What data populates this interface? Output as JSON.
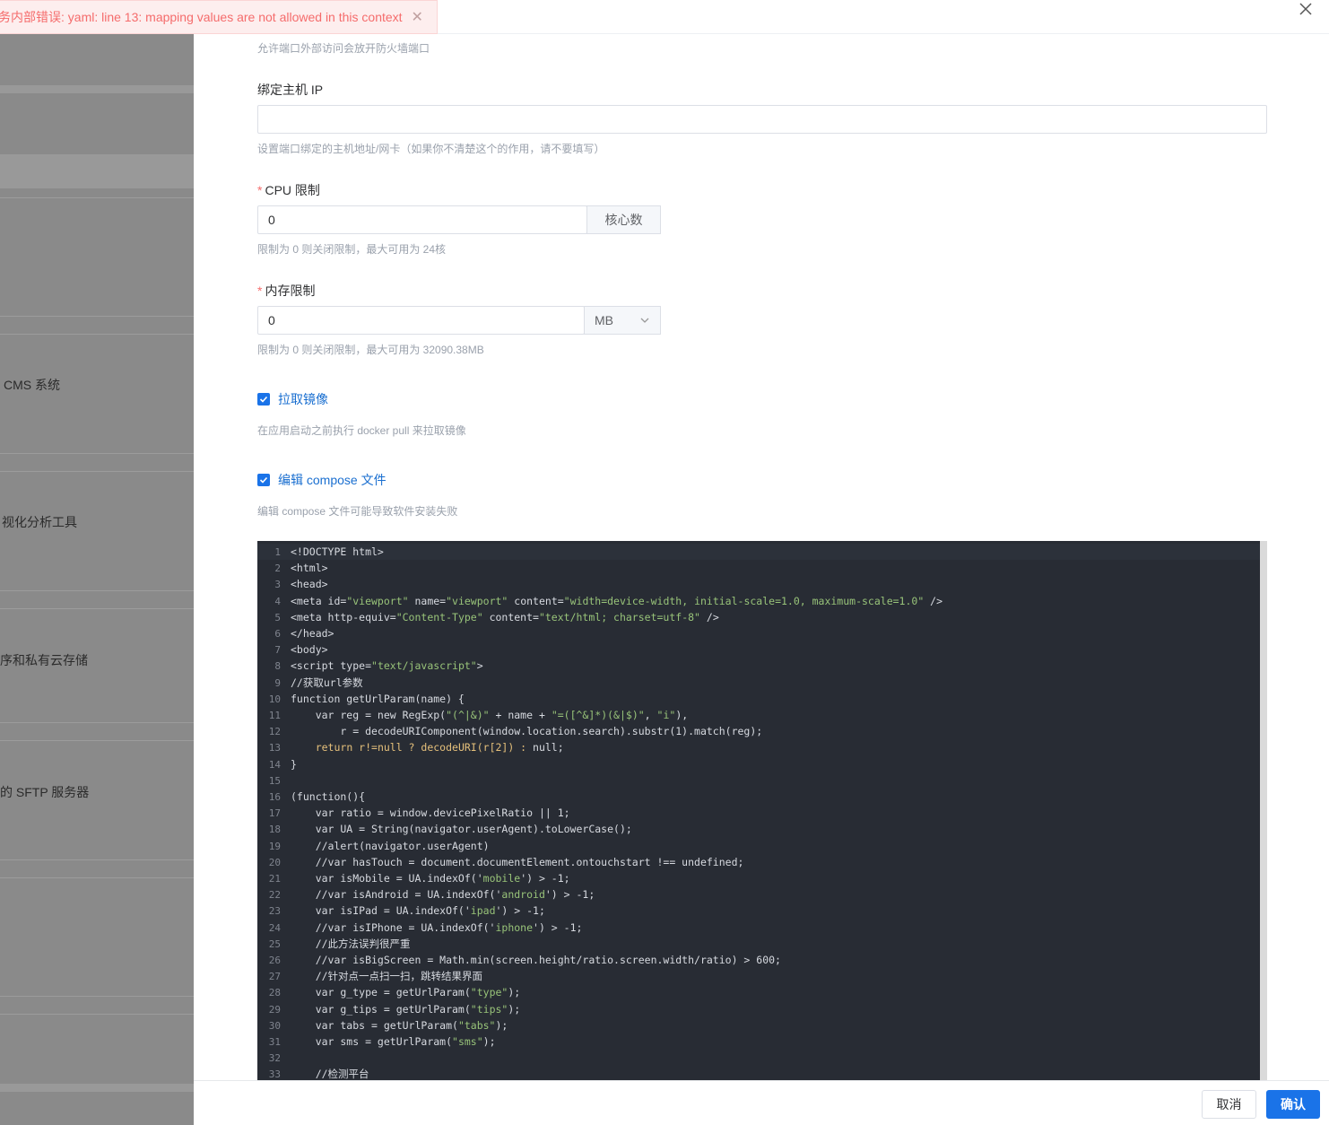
{
  "error_toast": {
    "message": "务内部错误: yaml: line 13: mapping values are not allowed in this context"
  },
  "background": {
    "labels": [
      "CMS 系统",
      "视化分析工具",
      "序和私有云存储",
      "的 SFTP 服务器"
    ]
  },
  "form": {
    "port_help": "允许端口外部访问会放开防火墙端口",
    "host_ip": {
      "label": "绑定主机 IP",
      "value": "",
      "help": "设置端口绑定的主机地址/网卡（如果你不清楚这个的作用，请不要填写）"
    },
    "cpu": {
      "label": "CPU 限制",
      "value": "0",
      "unit": "核心数",
      "help": "限制为 0 则关闭限制，最大可用为 24核"
    },
    "memory": {
      "label": "内存限制",
      "value": "0",
      "unit": "MB",
      "help": "限制为 0 则关闭限制，最大可用为 32090.38MB"
    },
    "pull_image": {
      "label": "拉取镜像",
      "checked": true,
      "help": "在应用启动之前执行 docker pull 来拉取镜像"
    },
    "edit_compose": {
      "label": "编辑 compose 文件",
      "checked": true,
      "help": "编辑 compose 文件可能导致软件安装失败"
    }
  },
  "editor": {
    "lines": [
      "<!DOCTYPE html>",
      "<html>",
      "<head>",
      "<meta id=\"viewport\" name=\"viewport\" content=\"width=device-width, initial-scale=1.0, maximum-scale=1.0\" />",
      "<meta http-equiv=\"Content-Type\" content=\"text/html; charset=utf-8\" />",
      "</head>",
      "<body>",
      "<script type=\"text/javascript\">",
      "//获取url参数",
      "function getUrlParam(name) {",
      "    var reg = new RegExp(\"(^|&)\" + name + \"=([^&]*)(&|$)\", \"i\"),",
      "        r = decodeURIComponent(window.location.search).substr(1).match(reg);",
      "    return r!=null ? decodeURI(r[2]) : null;",
      "}",
      "",
      "(function(){",
      "    var ratio = window.devicePixelRatio || 1;",
      "    var UA = String(navigator.userAgent).toLowerCase();",
      "    //alert(navigator.userAgent)",
      "    //var hasTouch = document.documentElement.ontouchstart !== undefined;",
      "    var isMobile = UA.indexOf('mobile') > -1;",
      "    //var isAndroid = UA.indexOf('android') > -1;",
      "    var isIPad = UA.indexOf('ipad') > -1;",
      "    //var isIPhone = UA.indexOf('iphone') > -1;",
      "    //此方法误判很严重",
      "    //var isBigScreen = Math.min(screen.height/ratio.screen.width/ratio) > 600;",
      "    //针对点一点扫一扫，跳转结果界面",
      "    var g_type = getUrlParam(\"type\");",
      "    var g_tips = getUrlParam(\"tips\");",
      "    var tabs = getUrlParam(\"tabs\");",
      "    var sms = getUrlParam(\"sms\");",
      "",
      "    //检测平台"
    ]
  },
  "footer": {
    "cancel_label": "取消",
    "confirm_label": "确认"
  },
  "colors": {
    "accent": "#1a73e8",
    "error": "#f56c6c",
    "editor_bg": "#282c34"
  }
}
